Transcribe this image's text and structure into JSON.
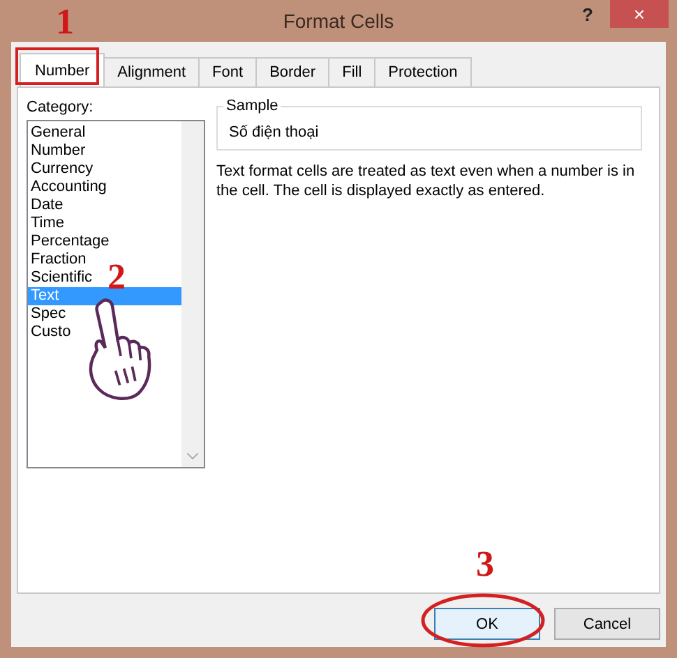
{
  "window": {
    "title": "Format Cells",
    "help": "?",
    "close": "×"
  },
  "tabs": [
    {
      "label": "Number",
      "selected": true
    },
    {
      "label": "Alignment",
      "selected": false
    },
    {
      "label": "Font",
      "selected": false
    },
    {
      "label": "Border",
      "selected": false
    },
    {
      "label": "Fill",
      "selected": false
    },
    {
      "label": "Protection",
      "selected": false
    }
  ],
  "category": {
    "label": "Category:",
    "items": [
      {
        "label": "General",
        "selected": false
      },
      {
        "label": "Number",
        "selected": false
      },
      {
        "label": "Currency",
        "selected": false
      },
      {
        "label": "Accounting",
        "selected": false
      },
      {
        "label": "Date",
        "selected": false
      },
      {
        "label": "Time",
        "selected": false
      },
      {
        "label": "Percentage",
        "selected": false
      },
      {
        "label": "Fraction",
        "selected": false
      },
      {
        "label": "Scientific",
        "selected": false
      },
      {
        "label": "Text",
        "selected": true
      },
      {
        "label": "Spec",
        "selected": false
      },
      {
        "label": "Custo",
        "selected": false
      }
    ]
  },
  "sample": {
    "label": "Sample",
    "value": "Số điện thoại"
  },
  "description": "Text format cells are treated as text even when a number is in the cell.  The cell is displayed exactly as entered.",
  "buttons": [
    {
      "label": "OK",
      "default": true
    },
    {
      "label": "Cancel",
      "default": false
    }
  ],
  "annotations": [
    "1",
    "2",
    "3"
  ]
}
